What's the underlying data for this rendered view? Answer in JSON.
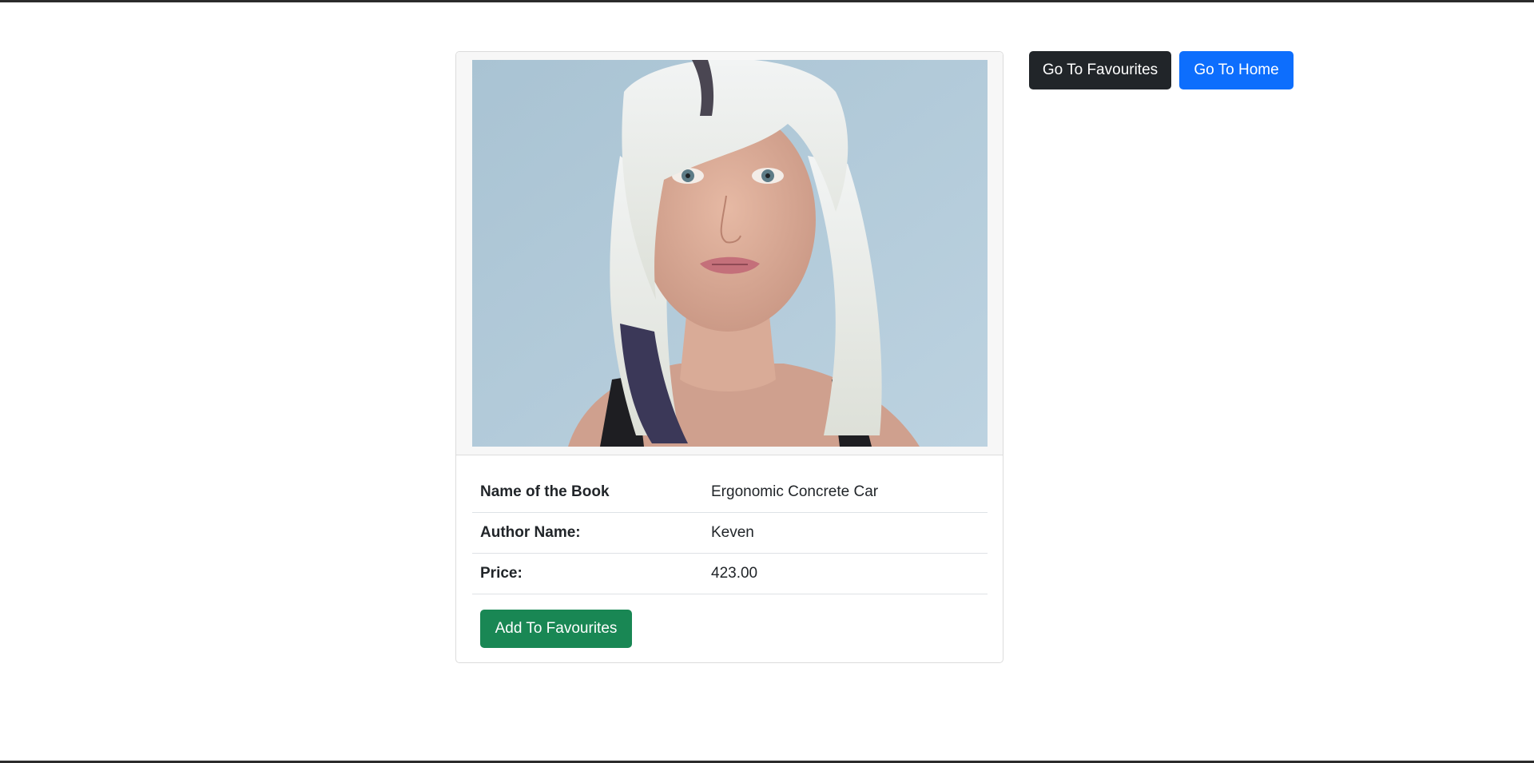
{
  "book": {
    "cover_image": "portrait-photo",
    "fields": [
      {
        "label": "Name of the Book",
        "value": "Ergonomic Concrete Car"
      },
      {
        "label": "Author Name:",
        "value": "Keven"
      },
      {
        "label": "Price:",
        "value": "423.00"
      }
    ],
    "add_button_label": "Add To Favourites"
  },
  "nav": {
    "favourites_button_label": "Go To Favourites",
    "home_button_label": "Go To Home"
  },
  "colors": {
    "add_button": "#198754",
    "favourites_button": "#212529",
    "home_button": "#0d6efd"
  }
}
